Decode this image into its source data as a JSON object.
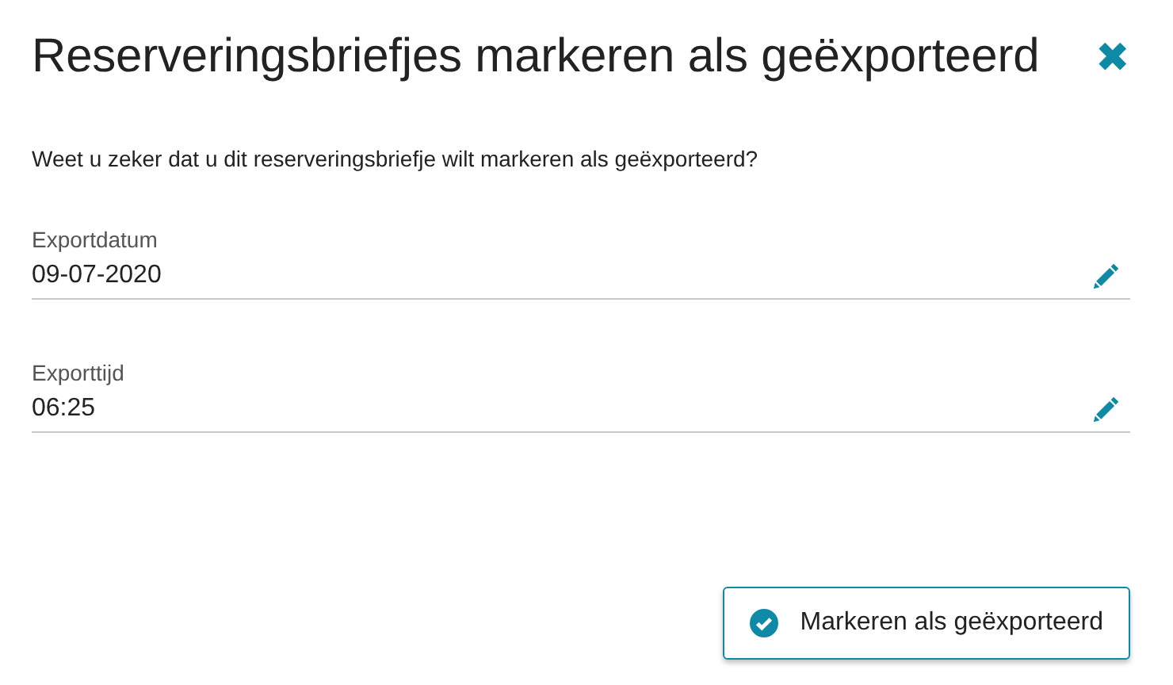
{
  "dialog": {
    "title": "Reserveringsbriefjes markeren als geëxporteerd",
    "close": "✖"
  },
  "message": "Weet u zeker dat u dit reserveringsbriefje wilt markeren als geëxporteerd?",
  "fields": [
    {
      "label": "Exportdatum",
      "value": "09-07-2020"
    },
    {
      "label": "Exporttijd",
      "value": "06:25"
    }
  ],
  "button": {
    "label": "Markeren als geëxporteerd"
  }
}
